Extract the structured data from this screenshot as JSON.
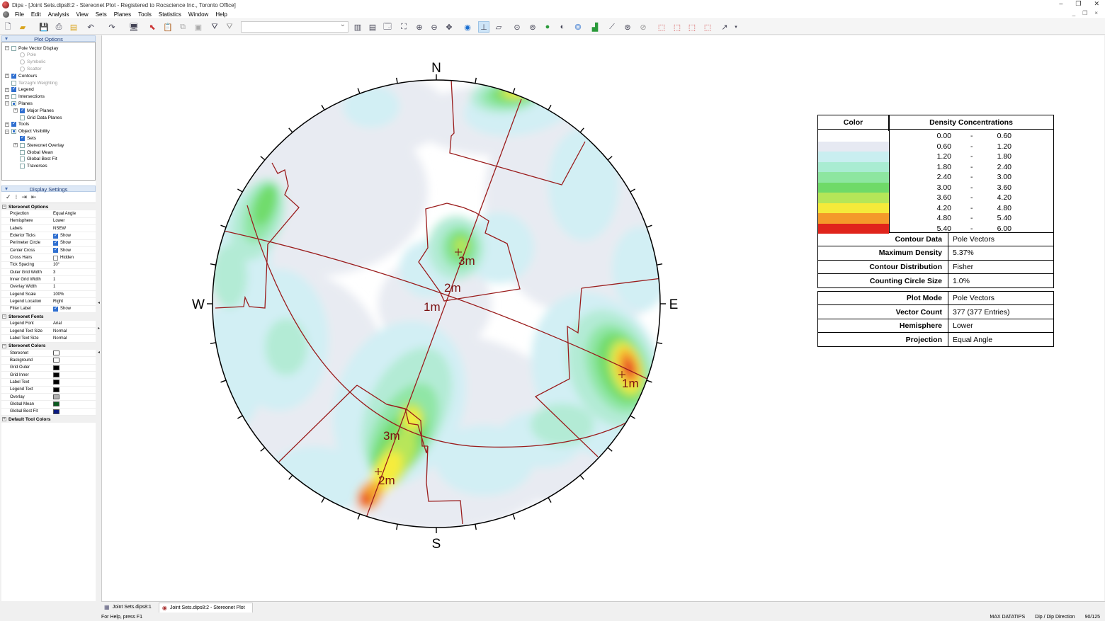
{
  "window": {
    "title": "Dips - [Joint Sets.dips8:2 - Stereonet Plot - Registered to Rocscience Inc., Toronto Office]",
    "controls": [
      "–",
      "❐",
      "✕"
    ],
    "mdi_controls": [
      "_",
      "❐",
      "×"
    ]
  },
  "menu": [
    "File",
    "Edit",
    "Analysis",
    "View",
    "Sets",
    "Planes",
    "Tools",
    "Statistics",
    "Window",
    "Help"
  ],
  "plot_options": {
    "header": "Plot Options",
    "tree": [
      {
        "label": "Pole Vector Display",
        "level": 0,
        "check": "off",
        "expander": "−"
      },
      {
        "label": "Pole",
        "level": 1,
        "radio": true,
        "grey": true
      },
      {
        "label": "Symbolic",
        "level": 1,
        "radio": true,
        "grey": true
      },
      {
        "label": "Scatter",
        "level": 1,
        "radio": true,
        "grey": true
      },
      {
        "label": "Contours",
        "level": 0,
        "check": "on",
        "expander": "+"
      },
      {
        "label": "Terzaghi Weighting",
        "level": 0,
        "check": "off",
        "grey": true
      },
      {
        "label": "Legend",
        "level": 0,
        "check": "on",
        "expander": "+"
      },
      {
        "label": "Intersections",
        "level": 0,
        "check": "off",
        "expander": "+"
      },
      {
        "label": "Planes",
        "level": 0,
        "check": "part",
        "expander": "−"
      },
      {
        "label": "Major Planes",
        "level": 1,
        "check": "on",
        "expander": "+"
      },
      {
        "label": "Grid Data Planes",
        "level": 1,
        "check": "off"
      },
      {
        "label": "Tools",
        "level": 0,
        "check": "on",
        "expander": "+"
      },
      {
        "label": "Object Visibility",
        "level": 0,
        "check": "part",
        "expander": "−"
      },
      {
        "label": "Sets",
        "level": 1,
        "check": "on"
      },
      {
        "label": "Stereonet Overlay",
        "level": 1,
        "check": "off",
        "expander": "+"
      },
      {
        "label": "Global Mean",
        "level": 1,
        "check": "off"
      },
      {
        "label": "Global Best Fit",
        "level": 1,
        "check": "off"
      },
      {
        "label": "Traverses",
        "level": 1,
        "check": "off"
      }
    ]
  },
  "display_settings": {
    "header": "Display Settings",
    "tool_icons": [
      "✓",
      "⁝",
      "⇥",
      "⇤"
    ],
    "groups": [
      {
        "title": "Stereonet Options",
        "rows": [
          {
            "k": "Projection",
            "v": "Equal Angle"
          },
          {
            "k": "Hemisphere",
            "v": "Lower"
          },
          {
            "k": "Labels",
            "v": "NSEW"
          },
          {
            "k": "Exterior Ticks",
            "v": "Show",
            "cb": true
          },
          {
            "k": "Perimeter Circle",
            "v": "Show",
            "cb": true
          },
          {
            "k": "Center Cross",
            "v": "Show",
            "cb": true
          },
          {
            "k": "Cross Hairs",
            "v": "Hidden",
            "cb": false
          },
          {
            "k": "Tick Spacing",
            "v": "10°"
          },
          {
            "k": "Outer Grid Width",
            "v": "3"
          },
          {
            "k": "Inner Grid Width",
            "v": "1"
          },
          {
            "k": "Overlay Width",
            "v": "1"
          },
          {
            "k": "Legend Scale",
            "v": "100%"
          },
          {
            "k": "Legend Location",
            "v": "Right"
          },
          {
            "k": "Filter Label",
            "v": "Show",
            "cb": true
          }
        ]
      },
      {
        "title": "Stereonet Fonts",
        "rows": [
          {
            "k": "Legend Font",
            "v": "Arial"
          },
          {
            "k": "Legend Text Size",
            "v": "Normal"
          },
          {
            "k": "Label Text Size",
            "v": "Normal"
          }
        ]
      },
      {
        "title": "Stereonet Colors",
        "rows": [
          {
            "k": "Stereonet",
            "color": "#ffffff"
          },
          {
            "k": "Background",
            "color": "#ffffff"
          },
          {
            "k": "Grid Outer",
            "color": "#000000"
          },
          {
            "k": "Grid Inner",
            "color": "#000000"
          },
          {
            "k": "Label Text",
            "color": "#000000"
          },
          {
            "k": "Legend Text",
            "color": "#000000"
          },
          {
            "k": "Overlay",
            "color": "#b0b0b0"
          },
          {
            "k": "Global Mean",
            "color": "#0a5a1e"
          },
          {
            "k": "Global Best Fit",
            "color": "#0b1a80"
          }
        ]
      },
      {
        "title": "Default Tool Colors",
        "rows": [],
        "collapsed": true
      }
    ]
  },
  "stereonet": {
    "labels": {
      "n": "N",
      "s": "S",
      "e": "E",
      "w": "W"
    },
    "annotations": [
      {
        "text": "3m",
        "set": 1
      },
      {
        "text": "2m",
        "set": 2
      },
      {
        "text": "1m",
        "set": 3
      },
      {
        "text": "1m",
        "set": 4
      },
      {
        "text": "3m",
        "set": 5
      },
      {
        "text": "2m",
        "set": 6
      }
    ],
    "contour_colors": [
      "#ffffff",
      "#e8ebf2",
      "#d2eff4",
      "#b3ebd5",
      "#90e6a6",
      "#71dc6c",
      "#b8e65a",
      "#f6ec3d",
      "#f4a72d",
      "#e8492b"
    ],
    "plane_color": "#9a1c1c"
  },
  "legend": {
    "col_color": "Color",
    "col_density": "Density Concentrations",
    "bins": [
      {
        "lo": "0.00",
        "hi": "0.60",
        "color": "#ffffff"
      },
      {
        "lo": "0.60",
        "hi": "1.20",
        "color": "#e6e9f2"
      },
      {
        "lo": "1.20",
        "hi": "1.80",
        "color": "#c9eef0"
      },
      {
        "lo": "1.80",
        "hi": "2.40",
        "color": "#a9ecd2"
      },
      {
        "lo": "2.40",
        "hi": "3.00",
        "color": "#8de6a0"
      },
      {
        "lo": "3.00",
        "hi": "3.60",
        "color": "#6fda68"
      },
      {
        "lo": "3.60",
        "hi": "4.20",
        "color": "#b5e658"
      },
      {
        "lo": "4.20",
        "hi": "4.80",
        "color": "#f5ea3a"
      },
      {
        "lo": "4.80",
        "hi": "5.40",
        "color": "#f49a2a"
      },
      {
        "lo": "5.40",
        "hi": "6.00",
        "color": "#e0241c"
      }
    ],
    "dash": "-",
    "info1": [
      {
        "k": "Contour Data",
        "v": "Pole Vectors"
      },
      {
        "k": "Maximum Density",
        "v": "5.37%"
      },
      {
        "k": "Contour Distribution",
        "v": "Fisher"
      },
      {
        "k": "Counting Circle Size",
        "v": "1.0%"
      }
    ],
    "info2": [
      {
        "k": "Plot Mode",
        "v": "Pole Vectors"
      },
      {
        "k": "Vector Count",
        "v": "377 (377 Entries)"
      },
      {
        "k": "Hemisphere",
        "v": "Lower"
      },
      {
        "k": "Projection",
        "v": "Equal Angle"
      }
    ]
  },
  "tabs": [
    {
      "label": "Joint Sets.dips8:1",
      "active": false
    },
    {
      "label": "Joint Sets.dips8:2 - Stereonet Plot",
      "active": true
    }
  ],
  "status": {
    "help": "For Help, press F1",
    "items": [
      "MAX DATATIPS",
      "Dip / Dip Direction",
      "90/125"
    ]
  }
}
